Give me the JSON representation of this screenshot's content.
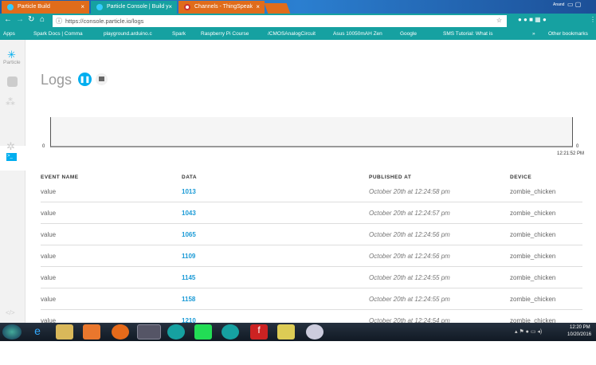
{
  "browser": {
    "tabs": [
      {
        "label": "Particle Build"
      },
      {
        "label": "Particle Console | Build y"
      },
      {
        "label": "Channels - ThingSpeak"
      }
    ],
    "user": "Anand",
    "url": "https://console.particle.io/logs",
    "bookmarks": [
      "Apps",
      "Spark Docs | Comma",
      "playground.arduino.c",
      "Spark",
      "Raspberry Pi Course",
      "/CMOSAnalogCircuit",
      "Asus 10050mAH Zen",
      "Google",
      "SMS Tutorial: What is"
    ],
    "other_bookmarks": "Other bookmarks"
  },
  "sidebar": {
    "brand": "Particle",
    "code_icon": "</>"
  },
  "page": {
    "title": "Logs"
  },
  "chart_data": {
    "type": "line",
    "y_ticks": [
      "0",
      "0"
    ],
    "right_y_tick": "0",
    "x_label": "12:21:52 PM",
    "series": []
  },
  "table": {
    "headers": [
      "EVENT NAME",
      "DATA",
      "PUBLISHED AT",
      "DEVICE"
    ],
    "rows": [
      [
        "value",
        "1013",
        "October 20th at 12:24:58 pm",
        "zombie_chicken"
      ],
      [
        "value",
        "1043",
        "October 20th at 12:24:57 pm",
        "zombie_chicken"
      ],
      [
        "value",
        "1065",
        "October 20th at 12:24:56 pm",
        "zombie_chicken"
      ],
      [
        "value",
        "1109",
        "October 20th at 12:24:56 pm",
        "zombie_chicken"
      ],
      [
        "value",
        "1145",
        "October 20th at 12:24:55 pm",
        "zombie_chicken"
      ],
      [
        "value",
        "1158",
        "October 20th at 12:24:55 pm",
        "zombie_chicken"
      ],
      [
        "value",
        "1210",
        "October 20th at 12:24:54 pm",
        "zombie_chicken"
      ]
    ]
  },
  "taskbar": {
    "time": "12:20 PM",
    "date": "10/20/2016"
  },
  "colors": {
    "accent": "#00aeef",
    "chrome": "#16a1a1"
  }
}
